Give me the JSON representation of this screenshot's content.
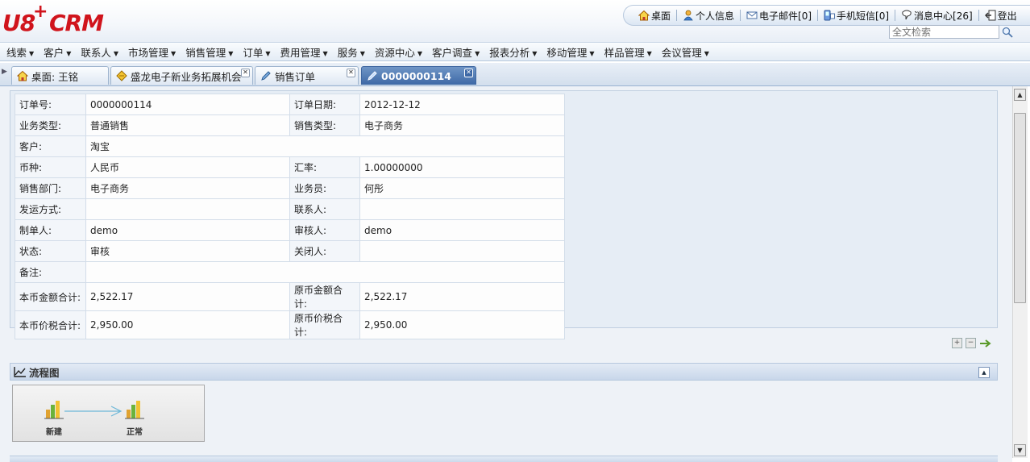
{
  "header": {
    "logo": {
      "main": "U8",
      "plus": "+",
      "brand": "CRM"
    },
    "links": [
      {
        "icon": "home-icon",
        "label": "桌面"
      },
      {
        "icon": "user-icon",
        "label": "个人信息"
      },
      {
        "icon": "mail-icon",
        "label": "电子邮件[0]"
      },
      {
        "icon": "phone-icon",
        "label": "手机短信[0]"
      },
      {
        "icon": "message-icon",
        "label": "消息中心[26]"
      },
      {
        "icon": "logout-icon",
        "label": "登出"
      }
    ],
    "search": {
      "placeholder": "全文检索"
    }
  },
  "menu": [
    "线索",
    "客户",
    "联系人",
    "市场管理",
    "销售管理",
    "订单",
    "费用管理",
    "服务",
    "资源中心",
    "客户调查",
    "报表分析",
    "移动管理",
    "样品管理",
    "会议管理"
  ],
  "tabs": [
    {
      "icon": "home-icon",
      "label": "桌面: 王铭",
      "active": false
    },
    {
      "icon": "opportunity-icon",
      "label": "盛龙电子新业务拓展机会",
      "active": false
    },
    {
      "icon": "edit-icon",
      "label": "销售订单",
      "active": false
    },
    {
      "icon": "edit-icon",
      "label": "0000000114",
      "active": true
    }
  ],
  "order": {
    "rows": [
      {
        "l1": "订单号:",
        "v1": "0000000114",
        "l2": "订单日期:",
        "v2": "2012-12-12"
      },
      {
        "l1": "业务类型:",
        "v1": "普通销售",
        "l2": "销售类型:",
        "v2": "电子商务"
      },
      {
        "l1": "客户:",
        "v1": "淘宝",
        "full": true
      },
      {
        "l1": "币种:",
        "v1": "人民币",
        "l2": "汇率:",
        "v2": "1.00000000"
      },
      {
        "l1": "销售部门:",
        "v1": "电子商务",
        "l2": "业务员:",
        "v2": "何彤"
      },
      {
        "l1": "发运方式:",
        "v1": "",
        "l2": "联系人:",
        "v2": ""
      },
      {
        "l1": "制单人:",
        "v1": "demo",
        "l2": "审核人:",
        "v2": "demo"
      },
      {
        "l1": "状态:",
        "v1": "审核",
        "l2": "关闭人:",
        "v2": ""
      },
      {
        "l1": "备注:",
        "v1": "",
        "full": true
      },
      {
        "l1": "本币金额合计:",
        "v1": "2,522.17",
        "l2": "原币金额合计:",
        "v2": "2,522.17"
      },
      {
        "l1": "本币价税合计:",
        "v1": "2,950.00",
        "l2": "原币价税合计:",
        "v2": "2,950.00"
      }
    ]
  },
  "flow": {
    "title": "流程图",
    "nodes": [
      {
        "label": "新建"
      },
      {
        "label": "正常"
      }
    ]
  },
  "colors": {
    "brand": "#d0141c",
    "active_tab": "#3d68a6"
  }
}
